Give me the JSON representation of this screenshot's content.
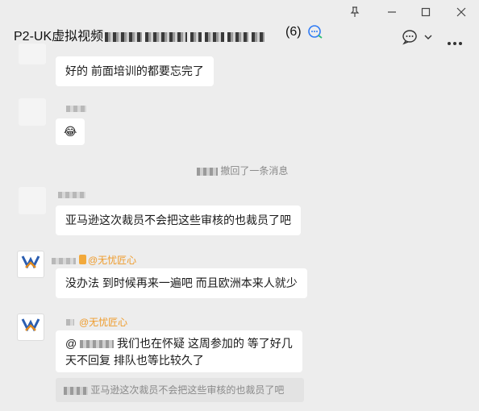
{
  "window": {
    "pin_icon": "pin-icon",
    "minimize_icon": "minimize-icon",
    "maximize_icon": "maximize-icon",
    "close_icon": "close-icon"
  },
  "header": {
    "title": "P2-UK虚拟视频",
    "member_count": "(6)",
    "edit_icon": "chat-edit-icon",
    "chat_info_icon": "speech-bubble-icon",
    "more_icon": "more-icon"
  },
  "messages": [
    {
      "text": "好的 前面培训的都要忘完了"
    },
    {
      "emoji": "😂"
    },
    {
      "system": "撤回了一条消息"
    },
    {
      "text": "亚马逊这次裁员不会把这些审核的也裁员了吧"
    },
    {
      "nickname": "@无忧匠心",
      "text": "没办法 到时候再来一遍吧 而且欧洲本来人就少"
    },
    {
      "nickname": "@无忧匠心",
      "text_line1": "我们也在怀疑 这周参加的 等了好几",
      "text_line2": "天不回复 排队也等比较久了",
      "mention_prefix": "@",
      "quote": "亚马逊这次裁员不会把这些审核的也裁员了吧"
    }
  ],
  "logo": {
    "caption": "无忧匠心"
  },
  "colors": {
    "background": "#ededed",
    "bubble": "#ffffff",
    "nickname": "#ee9b2a",
    "system_text": "#8a8a8a"
  }
}
